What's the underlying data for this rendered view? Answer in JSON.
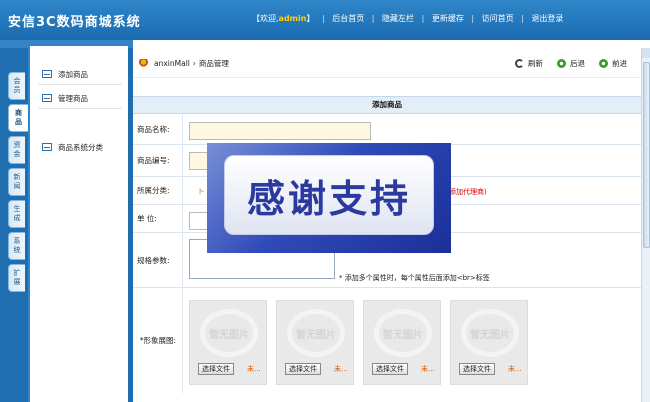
{
  "header": {
    "app_title": "安信3C数码商城系统",
    "welcome_prefix": "【欢迎,",
    "username": "admin",
    "welcome_suffix": "】",
    "nav": [
      "后台首页",
      "隐藏左栏",
      "更新缓存",
      "访问首页",
      "退出登录"
    ],
    "separator": "|"
  },
  "vertical_tabs": [
    {
      "label": [
        "会",
        "员"
      ],
      "active": false
    },
    {
      "label": [
        "商",
        "品"
      ],
      "active": true
    },
    {
      "label": [
        "资",
        "金"
      ],
      "active": false
    },
    {
      "label": [
        "新",
        "闻"
      ],
      "active": false
    },
    {
      "label": [
        "生",
        "成"
      ],
      "active": false
    },
    {
      "label": [
        "系",
        "统"
      ],
      "active": false
    },
    {
      "label": [
        "扩",
        "展"
      ],
      "active": false
    }
  ],
  "sidebar": {
    "items": [
      {
        "label": "添加商品"
      },
      {
        "label": "管理商品"
      },
      {
        "label": "商品系统分类"
      }
    ]
  },
  "breadcrumb": {
    "root": "anxinMall",
    "sep": "›",
    "current": "商品管理"
  },
  "toolbar": {
    "refresh": "刷新",
    "back": "后退",
    "forward": "前进"
  },
  "form": {
    "title": "添加商品",
    "name_label": "商品名称:",
    "code_label": "商品编号:",
    "category_label": "所属分类:",
    "category_hint": "添加代理商)",
    "unit_label": "单      位:",
    "spec_label": "规格参数:",
    "spec_hint": "* 添加多个属性时，每个属性后面添加<br>标签",
    "images_label": "*形象展图:",
    "image_placeholder": "暂无图片",
    "file_button": "选择文件",
    "file_status": "未..."
  },
  "overlay": {
    "text": "感谢支持"
  },
  "colors": {
    "header_blue": "#1b6bb0",
    "accent_yellow": "#ffd200",
    "input_bg": "#fff7e0",
    "hint_red": "#d40000"
  }
}
